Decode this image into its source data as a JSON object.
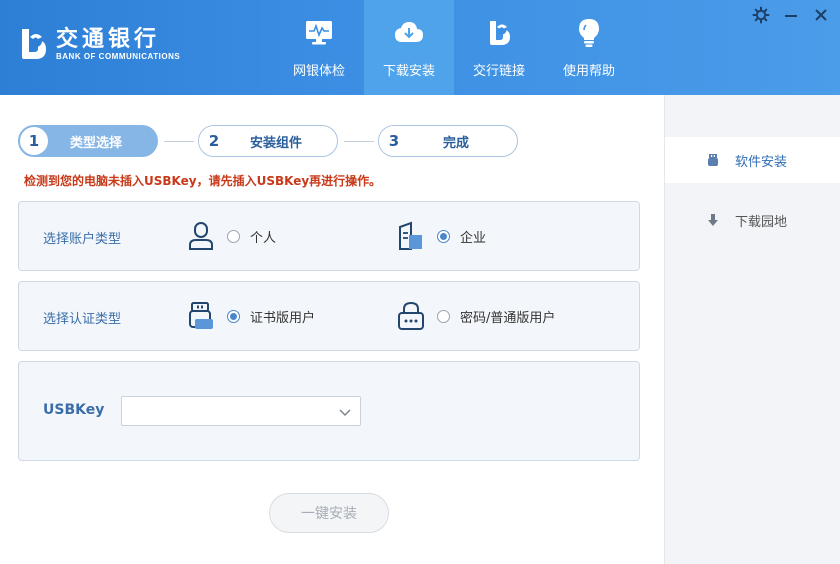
{
  "brand": {
    "name_cn": "交通银行",
    "name_en": "BANK OF COMMUNICATIONS"
  },
  "nav": [
    {
      "label": "网银体检",
      "icon": "monitor-pulse-icon",
      "active": false
    },
    {
      "label": "下载安装",
      "icon": "cloud-download-icon",
      "active": true
    },
    {
      "label": "交行链接",
      "icon": "bank-logo-link-icon",
      "active": false
    },
    {
      "label": "使用帮助",
      "icon": "lightbulb-icon",
      "active": false
    }
  ],
  "window": {
    "settings_icon": "gear-icon",
    "minimize_icon": "minimize-icon",
    "close_icon": "close-icon"
  },
  "steps": [
    {
      "num": "1",
      "label": "类型选择",
      "active": true
    },
    {
      "num": "2",
      "label": "安装组件",
      "active": false
    },
    {
      "num": "3",
      "label": "完成",
      "active": false
    }
  ],
  "warning": "检测到您的电脑未插入USBKey，请先插入USBKey再进行操作。",
  "account_type": {
    "label": "选择账户类型",
    "options": [
      {
        "label": "个人",
        "icon": "person-icon",
        "selected": false
      },
      {
        "label": "企业",
        "icon": "enterprise-building-icon",
        "selected": true
      }
    ]
  },
  "auth_type": {
    "label": "选择认证类型",
    "options": [
      {
        "label": "证书版用户",
        "icon": "usbkey-icon",
        "selected": true
      },
      {
        "label": "密码/普通版用户",
        "icon": "password-lock-icon",
        "selected": false
      }
    ]
  },
  "usbkey": {
    "label": "USBKey",
    "value": ""
  },
  "install_button": "一键安装",
  "sidebar": [
    {
      "label": "软件安装",
      "icon": "usb-device-icon",
      "active": true
    },
    {
      "label": "下载园地",
      "icon": "download-arrow-icon",
      "active": false
    }
  ],
  "colors": {
    "header": "#3b8ee3",
    "accent": "#4a86c8",
    "warning": "#c83a1a",
    "step_active": "#86b6e6"
  }
}
